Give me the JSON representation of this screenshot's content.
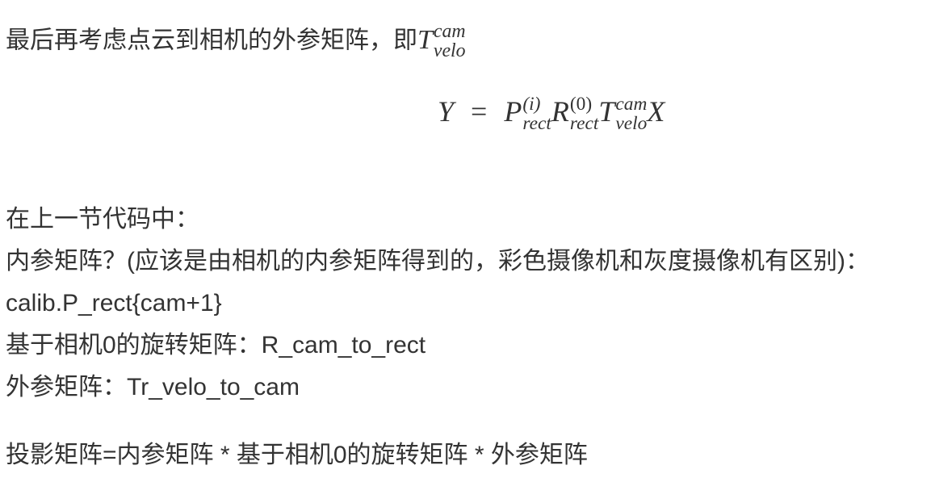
{
  "intro_line": {
    "text": "最后再考虑点云到相机的外参矩阵，即",
    "math_base": "T",
    "math_sup": "cam",
    "math_sub": "velo"
  },
  "equation": {
    "lhs": "Y",
    "op": "=",
    "p_base": "P",
    "p_sup": "(i)",
    "p_sub": "rect",
    "r_base": "R",
    "r_sup": "(0)",
    "r_sub": "rect",
    "t_base": "T",
    "t_sup": "cam",
    "t_sub": "velo",
    "x_var": "X"
  },
  "lines": {
    "section_intro": "在上一节代码中：",
    "intrinsic": "内参矩阵？(应该是由相机的内参矩阵得到的，彩色摄像机和灰度摄像机有区别)：",
    "intrinsic_code": "calib.P_rect{cam+1}",
    "rotation": "基于相机0的旋转矩阵：R_cam_to_rect",
    "extrinsic": "外参矩阵：Tr_velo_to_cam",
    "projection": "投影矩阵=内参矩阵 * 基于相机0的旋转矩阵 * 外参矩阵"
  }
}
